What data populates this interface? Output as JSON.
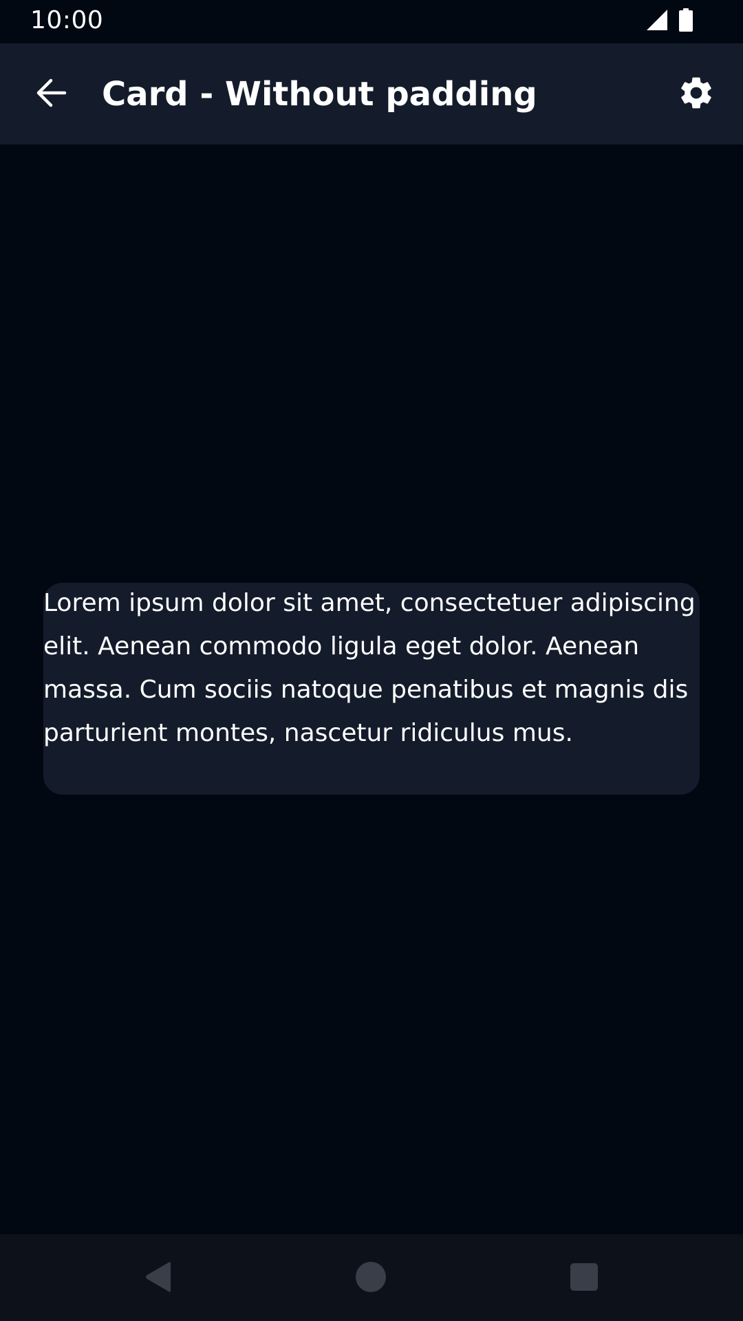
{
  "status_bar": {
    "time": "10:00",
    "icons": [
      "cellular-signal-icon",
      "battery-icon"
    ]
  },
  "app_bar": {
    "back_icon": "arrow-back-icon",
    "title": "Card - Without padding",
    "settings_icon": "gear-icon"
  },
  "card": {
    "text": "Lorem ipsum dolor sit amet, consectetuer adipiscing elit. Aenean commodo ligula eget dolor. Aenean massa. Cum sociis natoque penatibus et magnis dis parturient montes, nascetur ridiculus mus."
  },
  "nav_bar": {
    "icons": [
      "nav-back-icon",
      "nav-home-icon",
      "nav-recents-icon"
    ]
  },
  "colors": {
    "background": "#020812",
    "surface": "#141c2b",
    "nav_bar": "#0d111a",
    "nav_icons": "#3a3e49",
    "text": "#ffffff"
  }
}
